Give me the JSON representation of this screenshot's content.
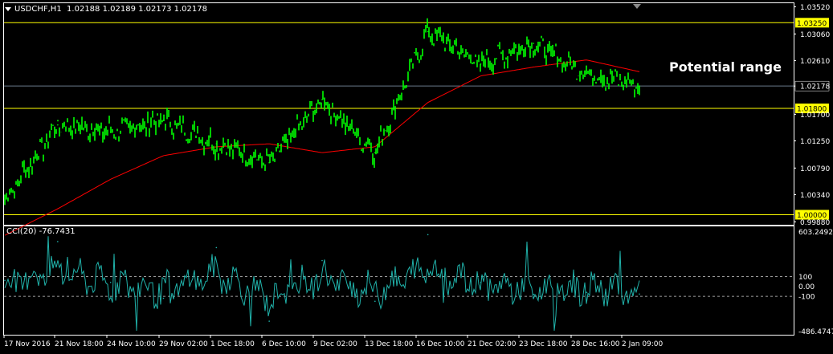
{
  "header": {
    "symbol": "USDCHF,H1",
    "ohlc": "1.02188 1.02189 1.02173 1.02178"
  },
  "annotation": "Potential range",
  "colors": {
    "price": "#00ff00",
    "ma": "#ff0000",
    "hline": "#ffff00",
    "cci": "#20b2aa",
    "grid": "#cccccc",
    "bid": "#6a7a8a"
  },
  "price_axis": {
    "ticks": [
      "1.03520",
      "1.03060",
      "1.02610",
      "1.02178",
      "1.01700",
      "1.01250",
      "1.00790",
      "1.00340",
      "0.99880"
    ],
    "values": [
      1.0352,
      1.0306,
      1.0261,
      1.02178,
      1.017,
      1.0125,
      1.0079,
      1.0034,
      0.9988
    ],
    "range": [
      0.9983,
      1.0358
    ]
  },
  "horizontal_levels": [
    {
      "label": "1.03250",
      "value": 1.0325
    },
    {
      "label": "1.01800",
      "value": 1.018
    },
    {
      "label": "1.00000",
      "value": 1.0
    }
  ],
  "current_price": {
    "label": "1.02178",
    "value": 1.02178
  },
  "cci": {
    "title": "CCI(20) -76.7431",
    "axis_ticks": [
      "603.2492",
      "100",
      "0.00",
      "-100",
      "-486.4747"
    ],
    "tick_values": [
      603.2492,
      100,
      0,
      -100,
      -486.4747
    ],
    "range": [
      -486.4747,
      603.2492
    ],
    "levels": [
      100,
      -100
    ]
  },
  "time_axis": [
    "17 Nov 2016",
    "21 Nov 18:00",
    "24 Nov 10:00",
    "29 Nov 02:00",
    "1 Dec 18:00",
    "6 Dec 10:00",
    "9 Dec 02:00",
    "13 Dec 18:00",
    "16 Dec 10:00",
    "21 Dec 02:00",
    "23 Dec 18:00",
    "28 Dec 16:00",
    "2 Jan 09:00"
  ],
  "chart_data": [
    {
      "type": "line",
      "title": "USDCHF,H1 1.02188 1.02189 1.02173 1.02178",
      "xlabel": "",
      "ylabel": "",
      "ylim": [
        0.9983,
        1.0358
      ],
      "x": [
        "17 Nov 2016",
        "21 Nov 18:00",
        "24 Nov 10:00",
        "29 Nov 02:00",
        "1 Dec 18:00",
        "6 Dec 10:00",
        "9 Dec 02:00",
        "13 Dec 18:00",
        "16 Dec 10:00",
        "21 Dec 02:00",
        "23 Dec 18:00",
        "28 Dec 16:00",
        "2 Jan 09:00"
      ],
      "series": [
        {
          "values": [
            1.0025,
            1.0152,
            1.014,
            1.016,
            1.012,
            1.0088,
            1.0195,
            1.0105,
            1.031,
            1.0255,
            1.029,
            1.024,
            1.0218
          ]
        },
        {
          "values": [
            0.9965,
            1.001,
            1.006,
            1.01,
            1.0115,
            1.012,
            1.0105,
            1.0115,
            1.019,
            1.0235,
            1.025,
            1.0262,
            1.0242
          ]
        }
      ],
      "grid": false
    },
    {
      "type": "line",
      "title": "CCI(20) -76.7431",
      "ylim": [
        -486.4747,
        603.2492
      ],
      "x": [
        "17 Nov 2016",
        "21 Nov 18:00",
        "24 Nov 10:00",
        "29 Nov 02:00",
        "1 Dec 18:00",
        "6 Dec 10:00",
        "9 Dec 02:00",
        "13 Dec 18:00",
        "16 Dec 10:00",
        "21 Dec 02:00",
        "23 Dec 18:00",
        "28 Dec 16:00",
        "2 Jan 09:00"
      ],
      "series": [
        {
          "values": [
            60,
            450,
            40,
            -120,
            390,
            -350,
            260,
            -150,
            520,
            40,
            -80,
            -60,
            -76.7431
          ]
        }
      ]
    }
  ]
}
